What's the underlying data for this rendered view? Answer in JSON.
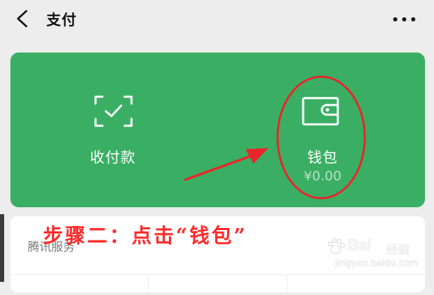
{
  "header": {
    "title": "支付",
    "back_icon": "chevron-left-icon",
    "more_icon": "more-dots-icon"
  },
  "card": {
    "color": "#3aaf64",
    "actions": [
      {
        "label": "收付款",
        "icon": "scan-check-icon"
      },
      {
        "label": "钱包",
        "icon": "wallet-icon",
        "balance": "¥0.00"
      }
    ]
  },
  "services": {
    "title": "腾讯服务"
  },
  "annotation": {
    "text": "步骤二：点击“钱包”",
    "color": "#ff2a2a"
  },
  "watermark": {
    "brand": "Bai",
    "suffix": "经验",
    "url": "jingyan.baidu.com"
  }
}
